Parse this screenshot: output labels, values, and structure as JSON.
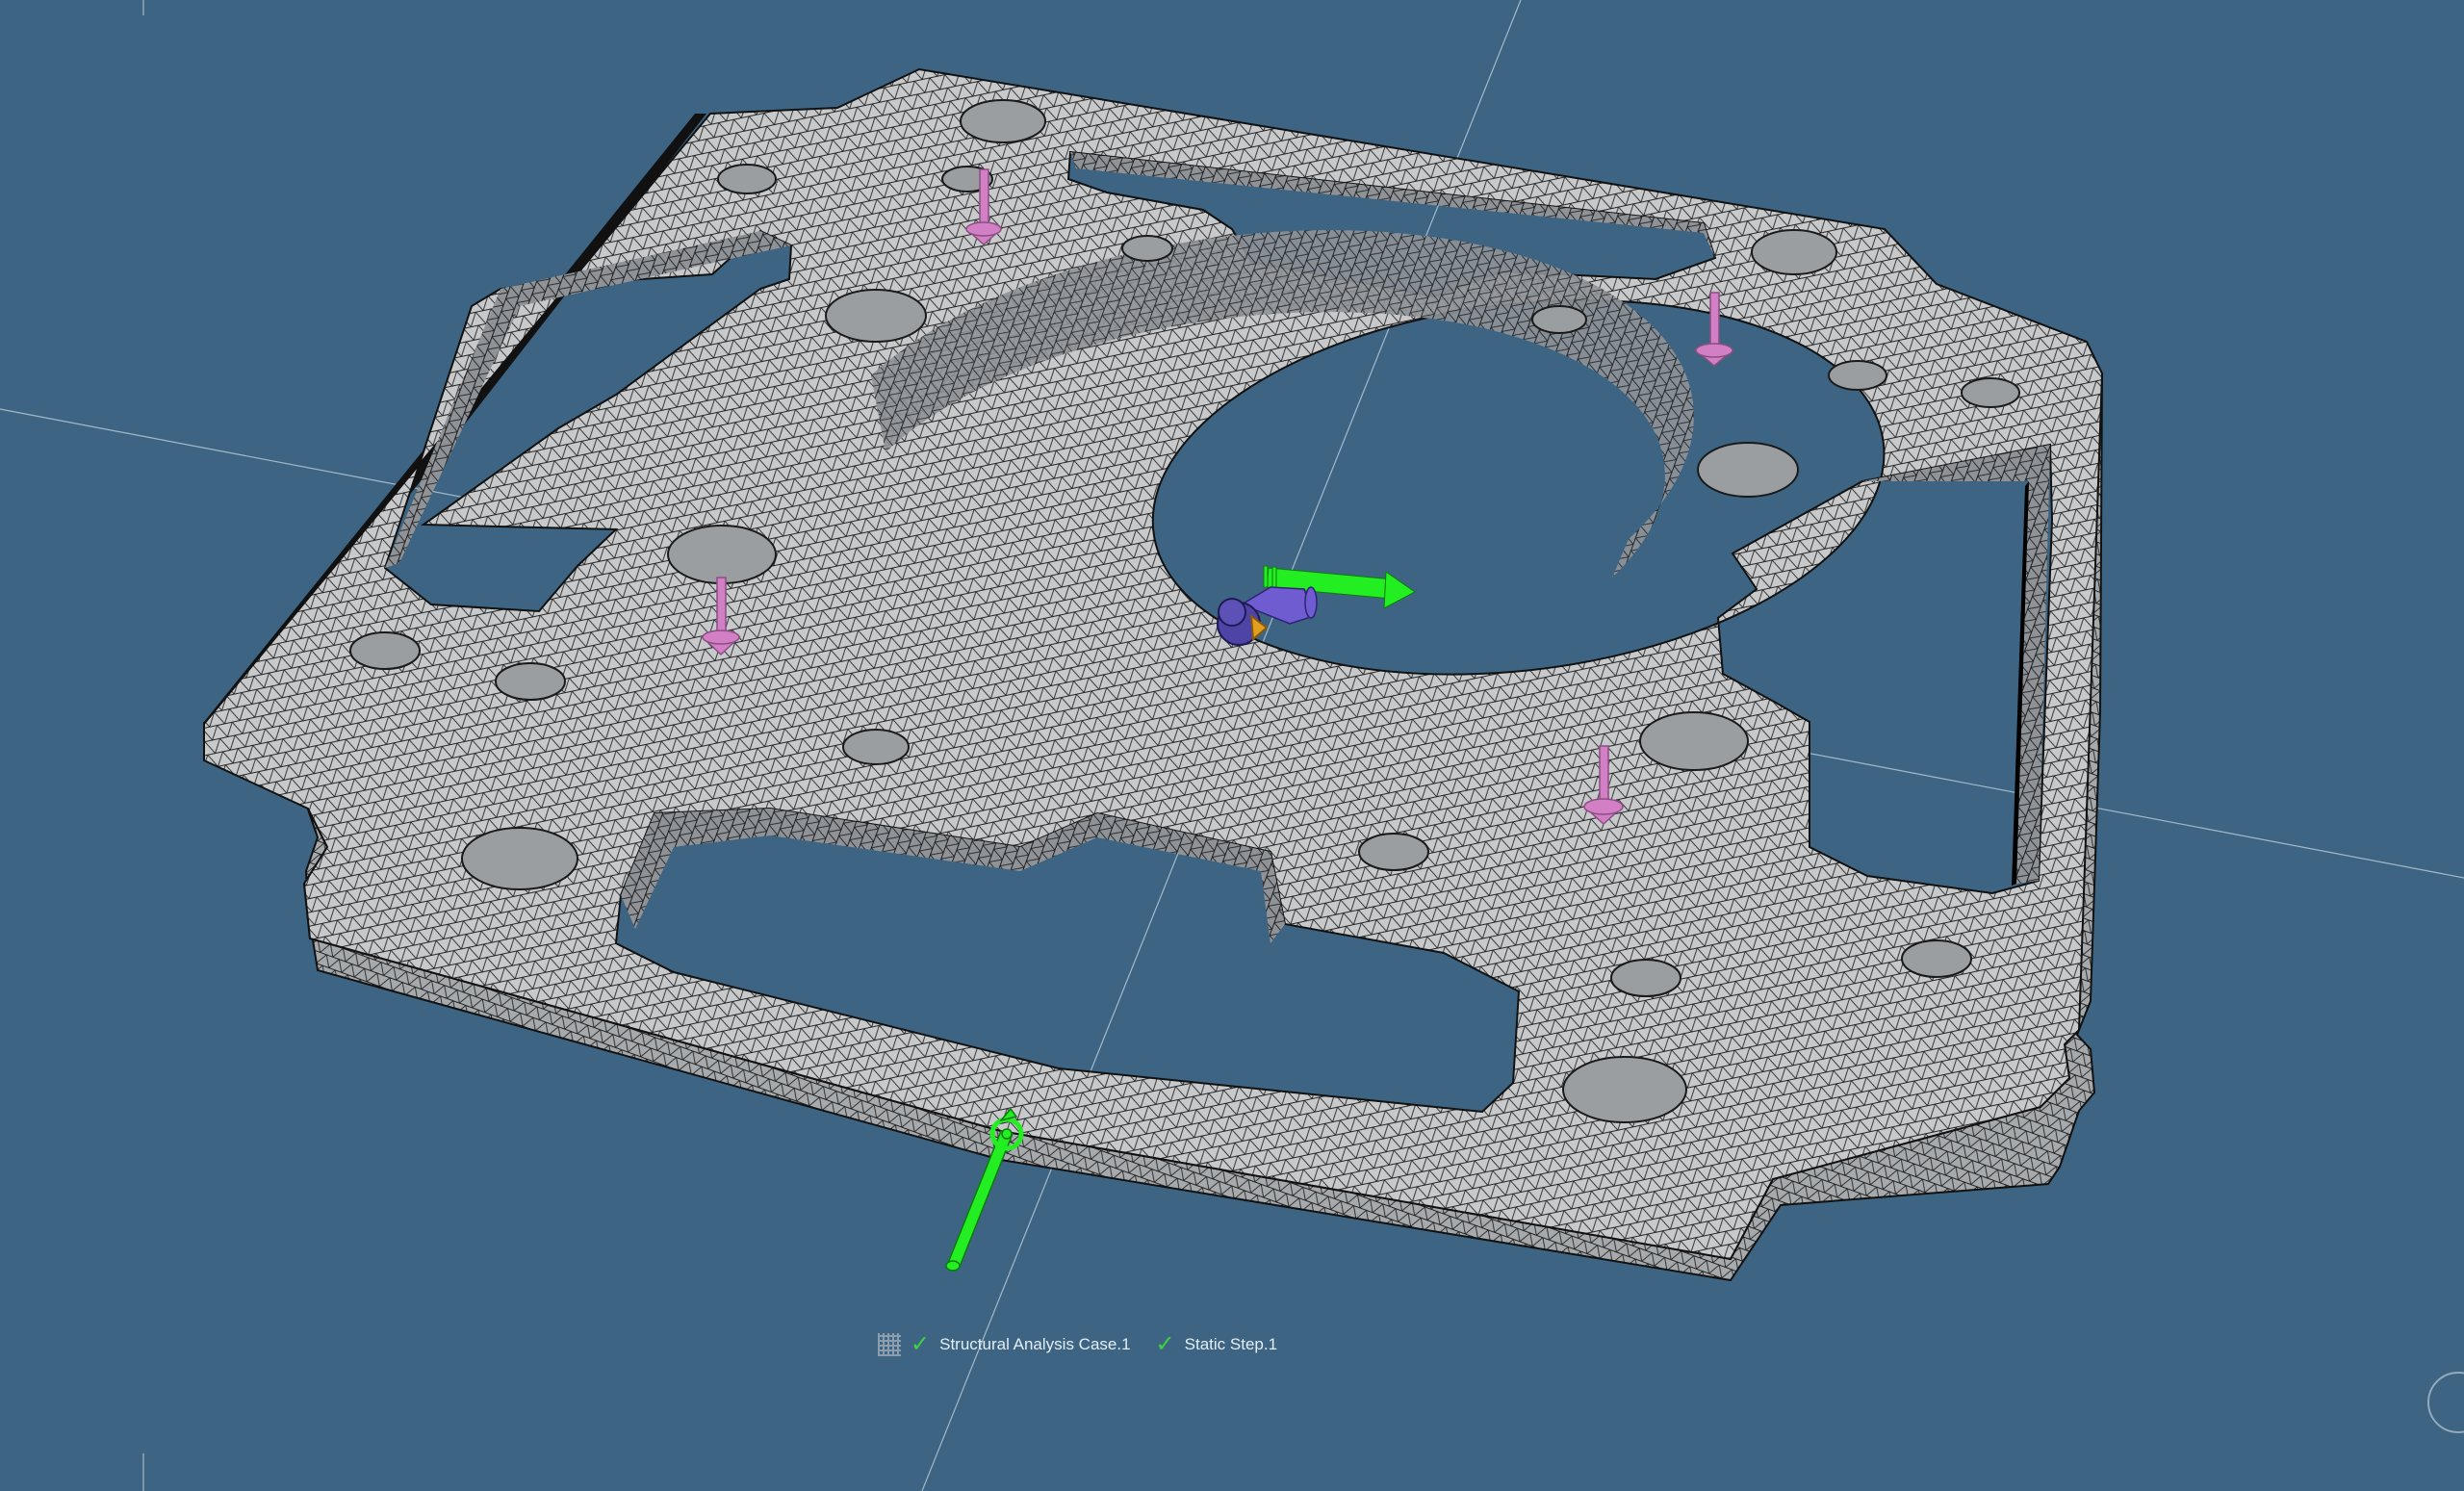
{
  "viewport": {
    "background_color": "#3d6583",
    "mesh_face_color": "#c9cbcd",
    "mesh_line_color": "#1e1e1e",
    "restraint_color": "#d27fc5",
    "load_color": "#22ee22",
    "axis_color": "#c6d6e2"
  },
  "status_bar": {
    "mesh_icon": "mesh-icon",
    "check_icon": "check-icon",
    "analysis_case_label": "Structural Analysis Case.1",
    "step_label": "Static Step.1"
  },
  "compass": {
    "icon": "compass-icon"
  }
}
